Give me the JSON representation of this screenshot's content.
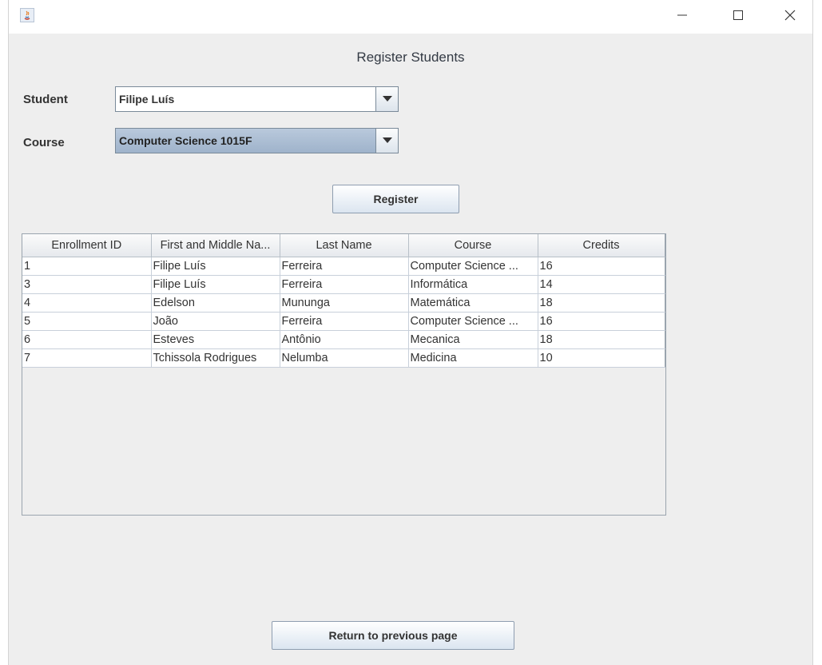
{
  "window": {
    "title": "",
    "controls": [
      "minimize-icon",
      "maximize-icon",
      "close-icon"
    ]
  },
  "heading": "Register Students",
  "student": {
    "label": "Student",
    "value": "Filipe Luís"
  },
  "course": {
    "label": "Course",
    "value": "Computer Science 1015F"
  },
  "register_button": "Register",
  "table": {
    "columns": [
      "Enrollment ID",
      "First and Middle Na...",
      "Last Name",
      "Course",
      "Credits"
    ],
    "rows": [
      [
        "1",
        "Filipe Luís",
        "Ferreira",
        "Computer Science ...",
        "16"
      ],
      [
        "3",
        "Filipe Luís",
        "Ferreira",
        "Informática",
        "14"
      ],
      [
        "4",
        "Edelson",
        "Mununga",
        "Matemática",
        "18"
      ],
      [
        "5",
        "João",
        "Ferreira",
        "Computer Science ...",
        "16"
      ],
      [
        "6",
        "Esteves",
        "Antônio",
        "Mecanica",
        "18"
      ],
      [
        "7",
        "Tchissola Rodrigues",
        "Nelumba",
        "Medicina",
        "10"
      ]
    ]
  },
  "return_button": "Return to previous page",
  "colors": {
    "selection": "#a8bad0",
    "window_bg": "#eeeeee",
    "button_top": "#ffffff",
    "button_bottom": "#dbe5f0"
  }
}
